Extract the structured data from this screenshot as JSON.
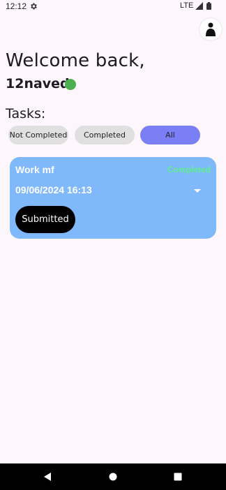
{
  "status_bar": {
    "time": "12:12",
    "network": "LTE",
    "icons": [
      "settings-gear-icon",
      "cell-signal-icon",
      "battery-icon"
    ]
  },
  "header": {
    "welcome": "Welcome back,",
    "username": "12naved",
    "online_color": "#4caf50"
  },
  "tasks": {
    "label": "Tasks:",
    "filters": [
      {
        "label": "Not Completed",
        "selected": false
      },
      {
        "label": "Completed",
        "selected": false
      },
      {
        "label": "All",
        "selected": true
      }
    ],
    "items": [
      {
        "title": "Work mf",
        "status": "Completed",
        "datetime": "09/06/2024 16:13",
        "action_label": "Submitted"
      }
    ]
  },
  "colors": {
    "background": "#fdf7fd",
    "filter_default": "#e0e0e0",
    "filter_selected": "#7b7ff5",
    "card": "#7fb8fb",
    "status_completed": "#5ff08c",
    "button": "#000000"
  },
  "nav_bar": {
    "icons": [
      "back-icon",
      "home-icon",
      "recents-icon"
    ]
  }
}
